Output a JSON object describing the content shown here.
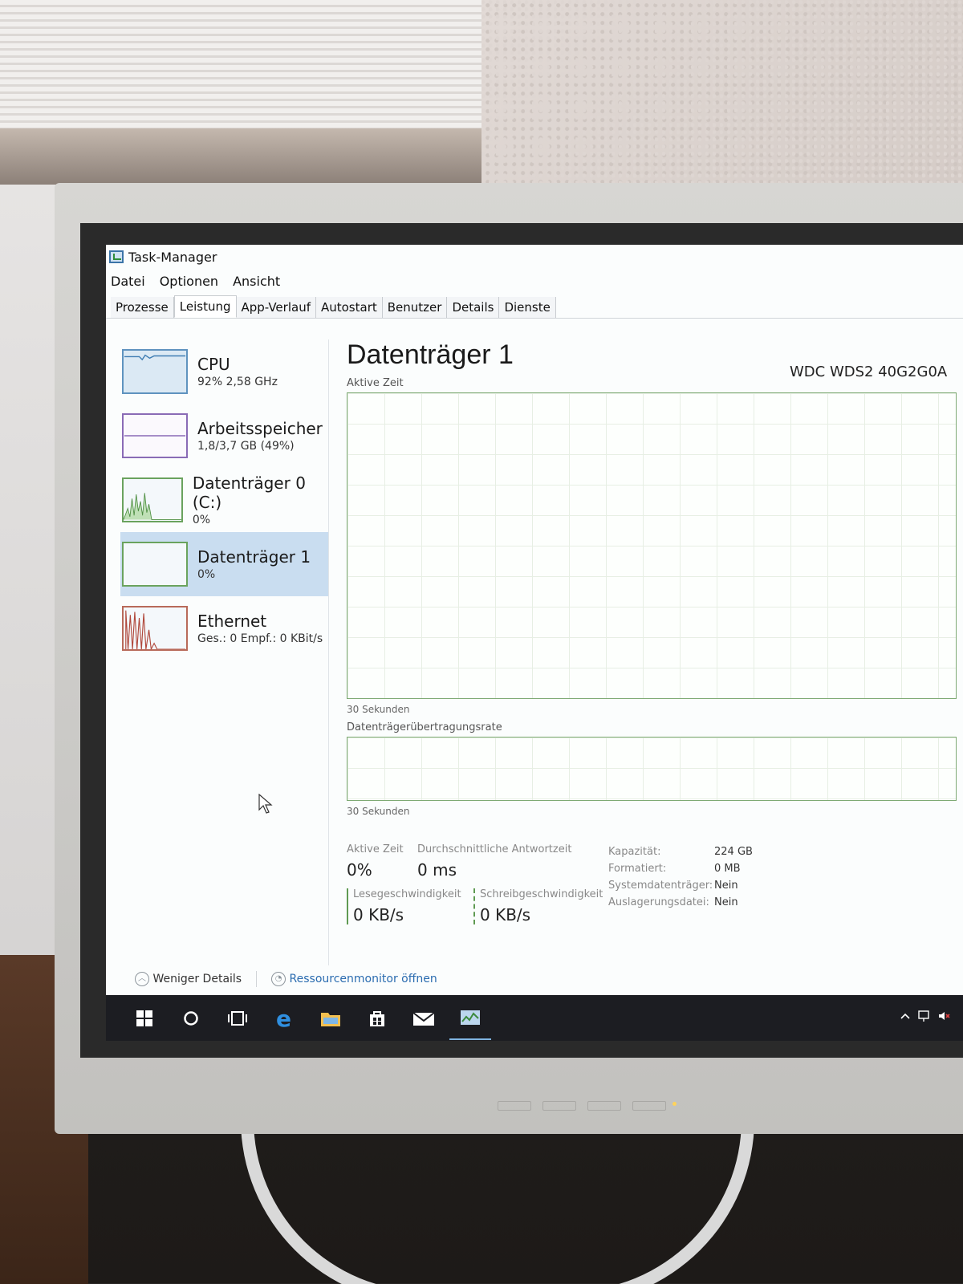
{
  "window": {
    "title": "Task-Manager"
  },
  "menu": [
    "Datei",
    "Optionen",
    "Ansicht"
  ],
  "tabs": [
    {
      "label": "Prozesse"
    },
    {
      "label": "Leistung"
    },
    {
      "label": "App-Verlauf"
    },
    {
      "label": "Autostart"
    },
    {
      "label": "Benutzer"
    },
    {
      "label": "Details"
    },
    {
      "label": "Dienste"
    }
  ],
  "active_tab": "Leistung",
  "sidebar": {
    "items": [
      {
        "name": "CPU",
        "value": "92% 2,58 GHz"
      },
      {
        "name": "Arbeitsspeicher",
        "value": "1,8/3,7 GB (49%)"
      },
      {
        "name": "Datenträger 0 (C:)",
        "value": "0%"
      },
      {
        "name": "Datenträger 1",
        "value": "0%"
      },
      {
        "name": "Ethernet",
        "value": "Ges.: 0 Empf.: 0 KBit/s"
      }
    ],
    "selected": "Datenträger 1"
  },
  "main": {
    "title": "Datenträger 1",
    "model": "WDC WDS2 40G2G0A",
    "chart1_label": "Aktive Zeit",
    "chart1_axis": "30 Sekunden",
    "chart2_label": "Datenträgerübertragungsrate",
    "chart2_axis": "30 Sekunden"
  },
  "stats": {
    "active_time": {
      "label": "Aktive Zeit",
      "value": "0%"
    },
    "avg_response": {
      "label": "Durchschnittliche Antwortzeit",
      "value": "0 ms"
    },
    "read_speed": {
      "label": "Lesegeschwindigkeit",
      "value": "0 KB/s"
    },
    "write_speed": {
      "label": "Schreibgeschwindigkeit",
      "value": "0 KB/s"
    }
  },
  "properties": [
    {
      "key": "Kapazität:",
      "value": "224 GB"
    },
    {
      "key": "Formatiert:",
      "value": "0 MB"
    },
    {
      "key": "Systemdatenträger:",
      "value": "Nein"
    },
    {
      "key": "Auslagerungsdatei:",
      "value": "Nein"
    }
  ],
  "footer": {
    "fewer_details": "Weniger Details",
    "resource_monitor": "Ressourcenmonitor öffnen"
  },
  "taskbar": {
    "icons": [
      "windows-start-icon",
      "search-circle-icon",
      "task-view-icon",
      "edge-browser-icon",
      "file-explorer-icon",
      "store-icon",
      "mail-icon",
      "task-manager-icon"
    ]
  },
  "colors": {
    "disk_accent": "#6aa35e",
    "selection": "#c9ddf0",
    "taskbar": "#1c1d22",
    "link": "#2b6cb0"
  }
}
